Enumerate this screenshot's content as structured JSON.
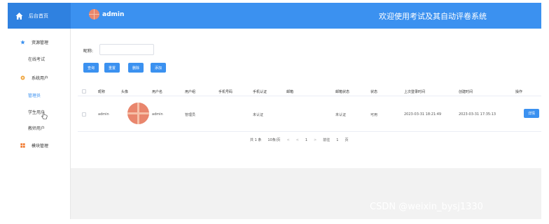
{
  "header": {
    "home_label": "后台首页",
    "username": "admin",
    "system_title": "欢迎使用考试及其自动评卷系统",
    "bar_color": "#3b91f0"
  },
  "sidebar": {
    "groups": [
      {
        "label": "资源管理",
        "icon": "star-icon",
        "items": [
          "在线考试"
        ]
      },
      {
        "label": "系统用户",
        "icon": "gear-icon",
        "items": [
          "管理员",
          "学生用户",
          "教师用户"
        ]
      },
      {
        "label": "模块管理",
        "icon": "grid-icon",
        "items": []
      }
    ],
    "active_item": "管理员"
  },
  "search": {
    "label": "昵称:",
    "value": ""
  },
  "toolbar": {
    "search": "查询",
    "reset": "重置",
    "delete": "删除",
    "add": "添加"
  },
  "table": {
    "columns": [
      "昵称",
      "头像",
      "用户名",
      "用户组",
      "手机号码",
      "手机认证",
      "邮箱",
      "邮箱状态",
      "状态",
      "上次登录时间",
      "创建时间",
      "操作"
    ],
    "rows": [
      {
        "nickname": "admin",
        "avatar": "avatar-icon",
        "username": "admin",
        "group": "管理员",
        "phone": "",
        "phone_state": "未认证",
        "email": "",
        "email_state": "未认证",
        "status": "可用",
        "last_login": "2023-03-31 18:21:49",
        "created": "2023-03-31 17:35:13",
        "action": "详情"
      }
    ]
  },
  "pagination": {
    "total": "共 1 条",
    "page_size": "10条/页",
    "current": "1",
    "goto_label": "前往",
    "goto_value": "1",
    "goto_suffix": "页"
  },
  "watermark": "CSDN @weixin_bysj1330"
}
